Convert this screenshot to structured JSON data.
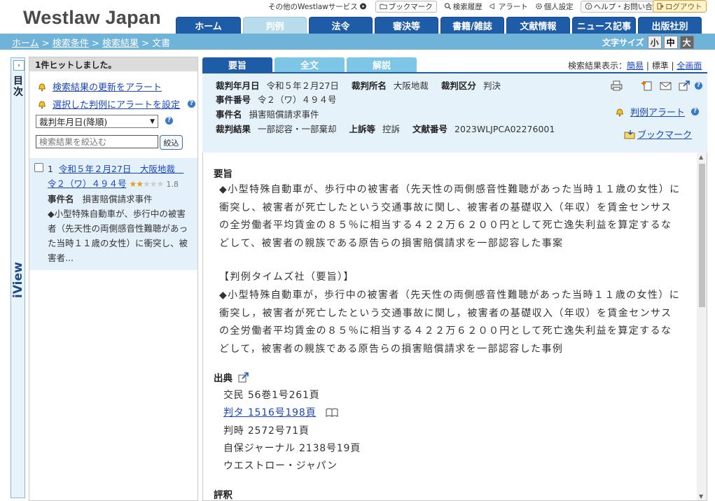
{
  "header": {
    "logo": "Westlaw Japan",
    "util_links": [
      {
        "label": "その他のWestlawサービス",
        "icon": "circle-arrow-icon"
      },
      {
        "label": "ブックマーク",
        "icon": "folder-icon"
      },
      {
        "label": "検索履歴",
        "icon": "search-icon"
      },
      {
        "label": "アラート",
        "icon": "megaphone-icon"
      },
      {
        "label": "個人設定",
        "icon": "gear-icon"
      }
    ],
    "help": "ヘルプ・お問い合わせ",
    "logout": "ログアウト",
    "tabs": [
      "ホーム",
      "判例",
      "法令",
      "審決等",
      "書籍/雑誌",
      "文献情報",
      "ニュース記事",
      "出版社別"
    ],
    "active_tab": "判例"
  },
  "breadcrumb": {
    "home": "ホーム",
    "conditions": "検索条件",
    "results": "検索結果",
    "current": "文書",
    "sep": " > "
  },
  "fontsize": {
    "label": "文字サイズ",
    "small": "小",
    "medium": "中",
    "large": "大"
  },
  "rail": {
    "toc": "目次",
    "iview": "iView",
    "toggle": "›"
  },
  "results": {
    "hits": "1件ヒットしました。",
    "alert_update": "検索結果の更新をアラート",
    "alert_selected": "選択した判例にアラートを設定",
    "sort_value": "裁判年月日(降順)",
    "filter_placeholder": "検索結果を絞込む",
    "filter_button": "絞込",
    "item": {
      "index": "1",
      "title": "令和５年２月27日　大阪地裁　令２（ワ）４９４号",
      "rating": 1.8,
      "score": "1.8",
      "case_label": "事件名",
      "case_name": "損害賠償請求事件",
      "snippet": "◆小型特殊自動車が、歩行中の被害者（先天性の両側感音性難聴があった当時１１歳の女性）に衝突し、被害者..."
    }
  },
  "doc_tabs": [
    "要旨",
    "全文",
    "解説"
  ],
  "active_doc_tab": "要旨",
  "display_mode": {
    "label": "検索結果表示：",
    "simple": "簡易",
    "standard": "標準",
    "full": "全画面"
  },
  "meta": {
    "date_label": "裁判年月日",
    "date": "令和５年２月27日",
    "court_label": "裁判所名",
    "court": "大阪地裁",
    "type_label": "裁判区分",
    "type": "判決",
    "case_no_label": "事件番号",
    "case_no": "令２（ワ）４９４号",
    "case_name_label": "事件名",
    "case_name": "損害賠償請求事件",
    "result_label": "裁判結果",
    "result": "一部認容・一部棄却",
    "appeal_label": "上訴等",
    "appeal": "控訴",
    "docno_label": "文献番号",
    "docno": "2023WLJPCA02276001",
    "alert": "判例アラート",
    "bookmark": "ブックマーク"
  },
  "summary": {
    "heading": "要旨",
    "p1": "◆小型特殊自動車が、歩行中の被害者（先天性の両側感音性難聴があった当時１１歳の女性）に衝突し、被害者が死亡したという交通事故に関し、被害者の基礎収入（年収）を賃金センサスの全労働者平均賃金の８５％に相当する４２２万６２００円として死亡逸失利益を算定するなどして、被害者の親族である原告らの損害賠償請求を一部認容した事案",
    "p2_title": "【判例タイムズ社（要旨）】",
    "p2": "◆小型特殊自動車が，歩行中の被害者（先天性の両側感音性難聴があった当時１１歳の女性）に衝突し，被害者が死亡したという交通事故に関し，被害者の基礎収入（年収）を賃金センサスの全労働者平均賃金の８５％に相当する４２２万６２００円として死亡逸失利益を算定するなどして，被害者の親族である原告らの損害賠償請求を一部認容した事例"
  },
  "sources": {
    "heading": "出典",
    "items": [
      "交民 56巻1号261頁",
      "判タ 1516号198頁",
      "判時 2572号71頁",
      "自保ジャーナル 2138号19頁",
      "ウエストロー・ジャパン"
    ],
    "next_heading": "評釈"
  }
}
